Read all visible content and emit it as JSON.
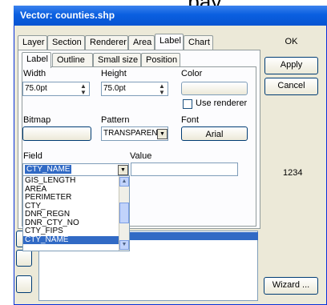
{
  "top_caption": "_____ _____ ___pay",
  "window": {
    "title": "Vector: counties.shp"
  },
  "tabs": [
    "Layer",
    "Section",
    "Renderer",
    "Area",
    "Label",
    "Chart"
  ],
  "subtabs": [
    "Label",
    "Outline",
    "Small size",
    "Position"
  ],
  "buttons": {
    "ok": "OK",
    "apply": "Apply",
    "cancel": "Cancel",
    "wizard": "Wizard ..."
  },
  "fields": {
    "width_label": "Width",
    "width_value": "75.0pt",
    "height_label": "Height",
    "height_value": "75.0pt",
    "color_label": "Color",
    "use_renderer": "Use renderer",
    "bitmap_label": "Bitmap",
    "pattern_label": "Pattern",
    "pattern_value": "TRANSPAREN",
    "font_label": "Font",
    "font_value": "Arial",
    "field_label": "Field",
    "field_value": "CTY_NAME",
    "value_label": "Value",
    "side_value": "1234"
  },
  "field_options": [
    "GIS_LENGTH",
    "AREA",
    "PERIMETER",
    "CTY_",
    "DNR_REGN",
    "DNR_CTY_NO",
    "CTY_FIPS",
    "CTY_NAME"
  ],
  "field_options_selected": "CTY_NAME",
  "icons": [
    "spin-up-down-icon",
    "dropdown-arrow-icon",
    "scroll-up-icon",
    "scroll-down-icon"
  ],
  "colors": {
    "titlebar": "#0754d2",
    "selection": "#316ac5",
    "face": "#ece9d8"
  }
}
